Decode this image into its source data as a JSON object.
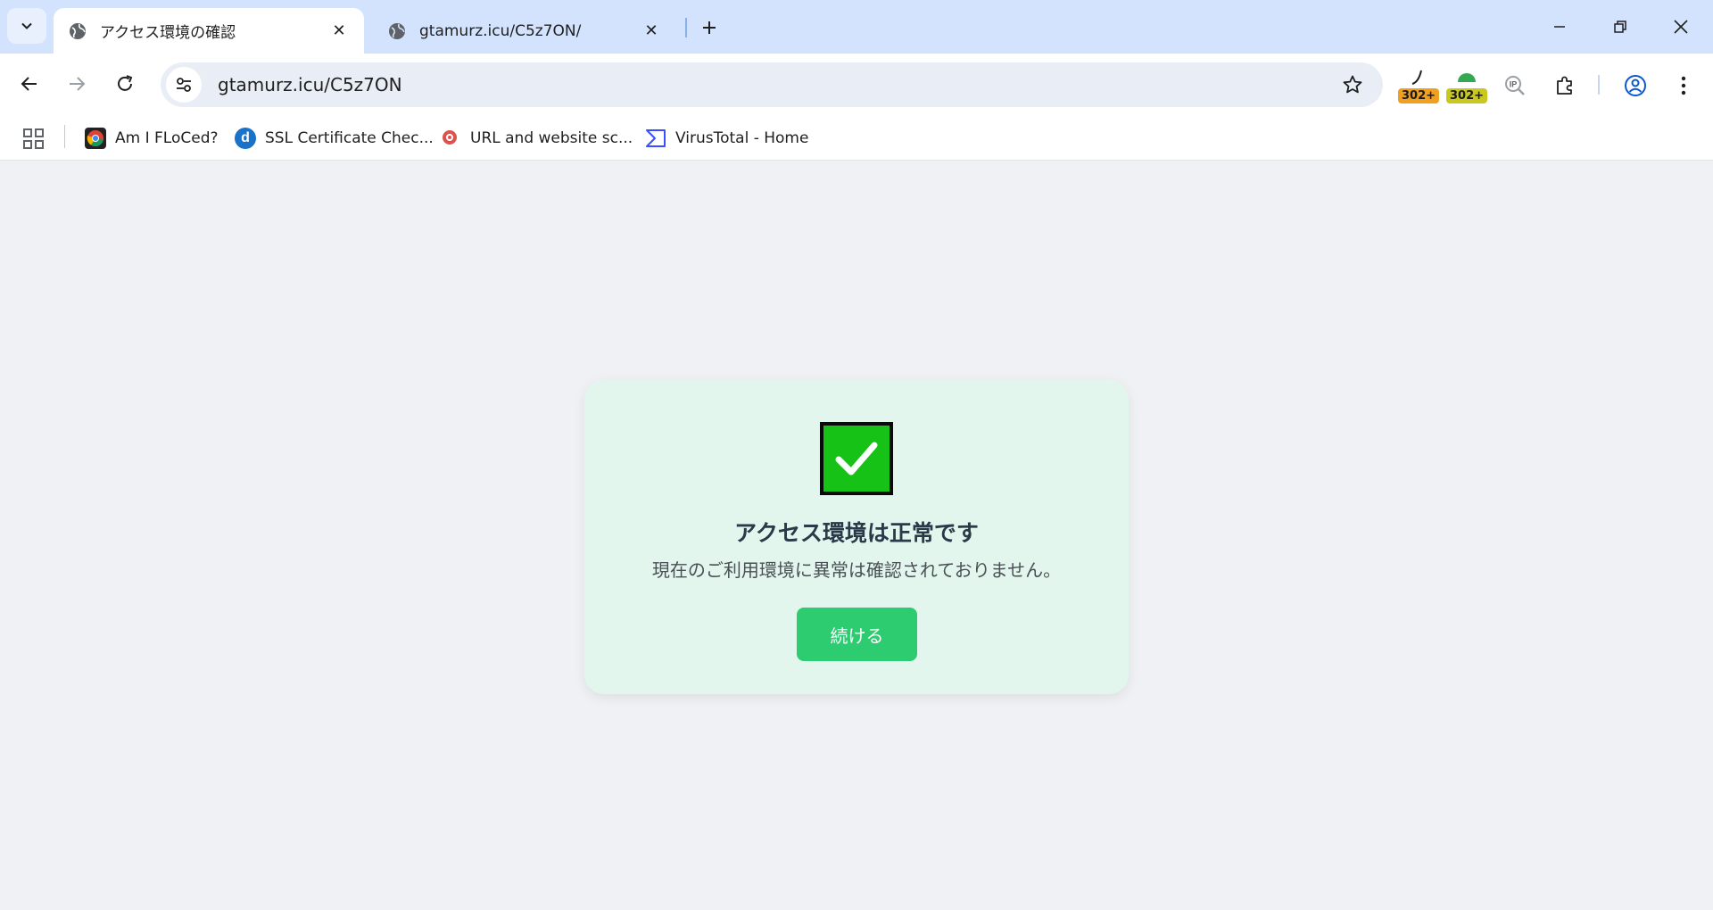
{
  "browser": {
    "tabs": [
      {
        "title": "アクセス環境の確認",
        "active": true
      },
      {
        "title": "gtamurz.icu/C5z7ON/",
        "active": false
      }
    ],
    "url": "gtamurz.icu/C5z7ON",
    "extensions": [
      {
        "name": "redirect-tracer-extension",
        "badge": "302+",
        "badge_color": "#f0a020"
      },
      {
        "name": "redirect-path-extension",
        "badge": "302+",
        "badge_color": "#c8c81e"
      },
      {
        "name": "ip-lookup-extension"
      },
      {
        "name": "extensions-puzzle-icon"
      }
    ],
    "bookmarks": [
      {
        "label": "Am I FLoCed?",
        "icon": "chrome-icon"
      },
      {
        "label": "SSL Certificate Chec...",
        "icon": "digicert-icon"
      },
      {
        "label": "URL and website sc...",
        "icon": "urlscan-icon"
      },
      {
        "label": "VirusTotal - Home",
        "icon": "virustotal-icon"
      }
    ]
  },
  "page": {
    "title": "アクセス環境は正常です",
    "message": "現在のご利用環境に異常は確認されておりません。",
    "button_label": "続ける",
    "accent_color": "#2ecc71",
    "check_color": "#16c216"
  }
}
